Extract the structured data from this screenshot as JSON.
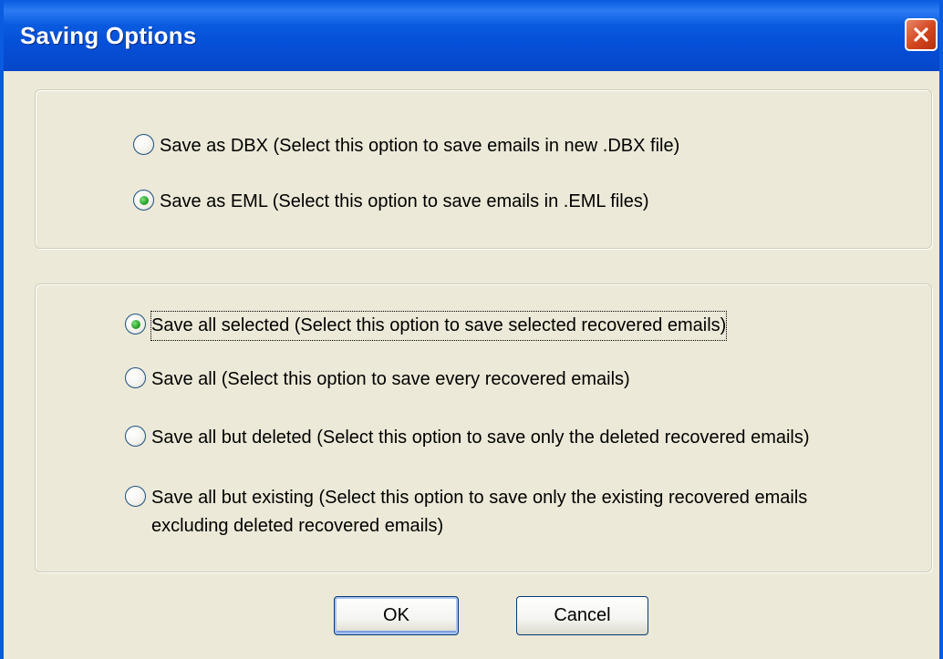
{
  "window": {
    "title": "Saving Options"
  },
  "title_bar": {
    "close_icon": "close-x-icon"
  },
  "format_group": {
    "options": [
      {
        "label": "Save as DBX (Select this option to save emails in new .DBX file)",
        "checked": false
      },
      {
        "label": "Save as EML (Select this option to save emails in .EML files)",
        "checked": true
      }
    ]
  },
  "scope_group": {
    "options": [
      {
        "label": "Save all selected (Select this option to save selected recovered emails)",
        "checked": true,
        "focused": true
      },
      {
        "label": "Save all (Select this option to save every recovered emails)",
        "checked": false
      },
      {
        "label": "Save all but deleted (Select this option to save only the deleted recovered emails)",
        "checked": false
      },
      {
        "label": "Save all but existing (Select this option to save only the existing recovered emails excluding deleted recovered emails)",
        "checked": false
      }
    ]
  },
  "buttons": {
    "ok_label": "OK",
    "cancel_label": "Cancel"
  },
  "colors": {
    "titlebar": "#0A5BE0",
    "dialog_bg": "#ECE9D8",
    "close_button": "#D2451E",
    "radio_dot": "#2AA22A",
    "button_border": "#003C74"
  }
}
